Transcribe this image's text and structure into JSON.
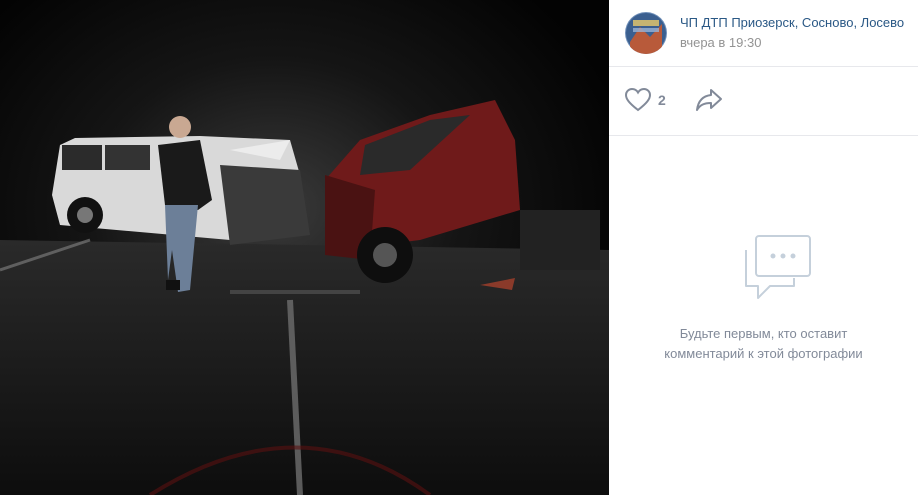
{
  "photo": {
    "alt_icon": "crash-photo"
  },
  "author": {
    "name": "ЧП ДТП Приозерск, Сосново, Лосево",
    "time": "вчера в 19:30",
    "avatar_icon": "community-avatar"
  },
  "actions": {
    "likes": "2",
    "like_icon": "heart-icon",
    "share_icon": "share-arrow-icon"
  },
  "comments": {
    "empty_line1": "Будьте первым, кто оставит",
    "empty_line2": "комментарий к этой фотографии"
  }
}
